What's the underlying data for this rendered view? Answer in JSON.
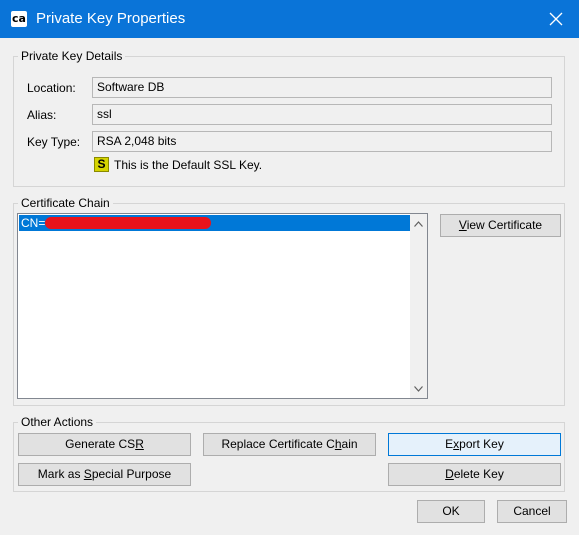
{
  "window": {
    "title": "Private Key Properties"
  },
  "details": {
    "group_title": "Private Key Details",
    "location_label": "Location:",
    "location_value": "Software DB",
    "alias_label": "Alias:",
    "alias_value": "ssl",
    "keytype_label": "Key Type:",
    "keytype_value": "RSA 2,048 bits",
    "ssl_badge": "S",
    "ssl_note": "This is the Default SSL Key."
  },
  "chain": {
    "group_title": "Certificate Chain",
    "items": [
      "CN="
    ],
    "view_certificate_pre": "",
    "view_certificate_mnemonic": "V",
    "view_certificate_post": "iew Certificate"
  },
  "actions": {
    "group_title": "Other Actions",
    "generate_csr_pre": "Generate CS",
    "generate_csr_mnemonic": "R",
    "generate_csr_post": "",
    "replace_chain_pre": "Replace Certificate C",
    "replace_chain_mnemonic": "h",
    "replace_chain_post": "ain",
    "export_key_pre": "E",
    "export_key_mnemonic": "x",
    "export_key_post": "port Key",
    "mark_special_pre": "Mark as ",
    "mark_special_mnemonic": "S",
    "mark_special_post": "pecial Purpose",
    "delete_key_pre": "",
    "delete_key_mnemonic": "D",
    "delete_key_post": "elete Key"
  },
  "footer": {
    "ok_label": "OK",
    "cancel_label": "Cancel"
  },
  "colors": {
    "titlebar": "#0a74d8",
    "selection": "#0078d7",
    "ssl_badge": "#d5d400",
    "redaction": "#e8131b"
  }
}
